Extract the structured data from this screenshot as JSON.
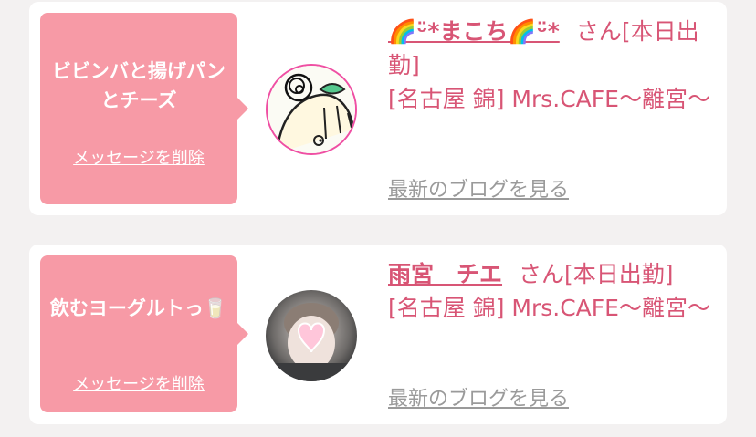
{
  "entries": [
    {
      "message": "ビビンバと揚げパンとチーズ",
      "delete_label": "メッセージを削除",
      "name": "🌈ᵕ̈*まこち🌈ᵕ̈*",
      "honorific": "さん",
      "status": "[本日出勤]",
      "shop": "[名古屋 錦] Mrs.CAFE〜離宮〜",
      "blog_label": "最新のブログを見る"
    },
    {
      "message": "飲むヨーグルトっ🥛",
      "delete_label": "メッセージを削除",
      "name": "雨宮　チエ",
      "honorific": "さん",
      "status": "[本日出勤]",
      "shop": "[名古屋 錦] Mrs.CAFE〜離宮〜",
      "blog_label": "最新のブログを見る"
    }
  ]
}
